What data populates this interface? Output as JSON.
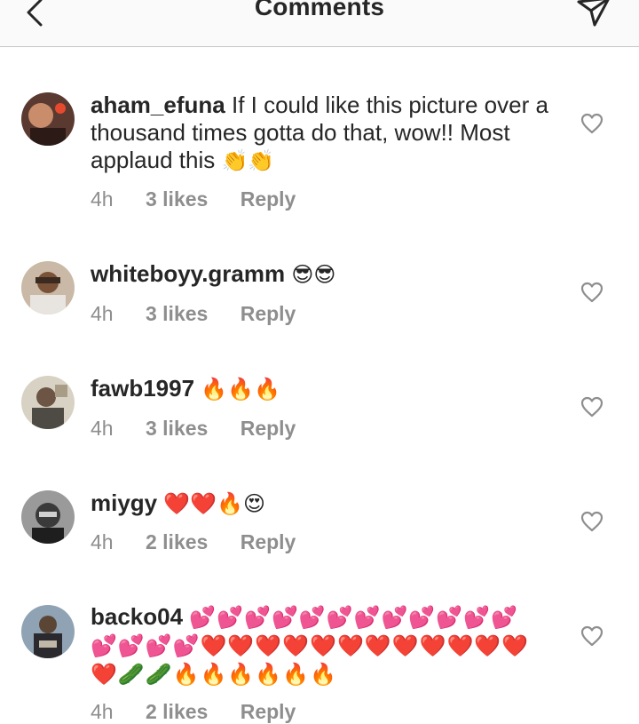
{
  "header": {
    "title": "Comments"
  },
  "comments": [
    {
      "username": "aham_efuna",
      "text": "If I could like this picture over a thousand times gotta do that, wow!! Most applaud this",
      "emoji": "👏👏",
      "time": "4h",
      "likes": "3 likes",
      "reply": "Reply"
    },
    {
      "username": "whiteboyy.gramm",
      "text": "",
      "emoji": "😎😎",
      "time": "4h",
      "likes": "3 likes",
      "reply": "Reply"
    },
    {
      "username": "fawb1997",
      "text": "",
      "emoji": "🔥🔥🔥",
      "time": "4h",
      "likes": "3 likes",
      "reply": "Reply"
    },
    {
      "username": "miygy",
      "text": "",
      "emoji": "❤️❤️🔥😍",
      "time": "4h",
      "likes": "2 likes",
      "reply": "Reply"
    },
    {
      "username": "backo04",
      "text": "",
      "emoji": "💕💕💕💕💕💕💕💕💕💕💕💕💕💕💕💕❤️❤️❤️❤️❤️❤️❤️❤️❤️❤️❤️❤️❤️🥒🥒🔥🔥🔥🔥🔥🔥",
      "time": "4h",
      "likes": "2 likes",
      "reply": "Reply"
    }
  ]
}
